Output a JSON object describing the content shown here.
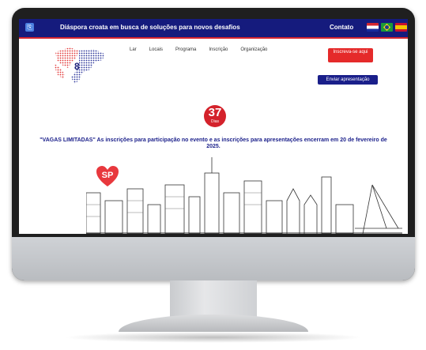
{
  "topbar": {
    "tagline": "Diáspora croata em busca de soluções para novos desafios",
    "contact_label": "Contato",
    "languages": [
      "croatian-flag",
      "brazil-flag",
      "spain-flag"
    ]
  },
  "logo": {
    "number": "8"
  },
  "nav": {
    "items": [
      "Lar",
      "Locais",
      "Programa",
      "Inscrição",
      "Organização"
    ]
  },
  "actions": {
    "register_label": "Inscreva-se aqui",
    "submit_label": "Enviar apresentação"
  },
  "countdown": {
    "value": "37",
    "unit": "Dias"
  },
  "notice": "\"VAGAS LIMITADAS\" As inscrições para participação no evento e as inscrições para apresentações encerram em 20 de fevereiro de 2025.",
  "hero": {
    "heart_text": "SP"
  },
  "colors": {
    "navy": "#151b7d",
    "red": "#e52a2a",
    "accent_red": "#d3252f"
  }
}
